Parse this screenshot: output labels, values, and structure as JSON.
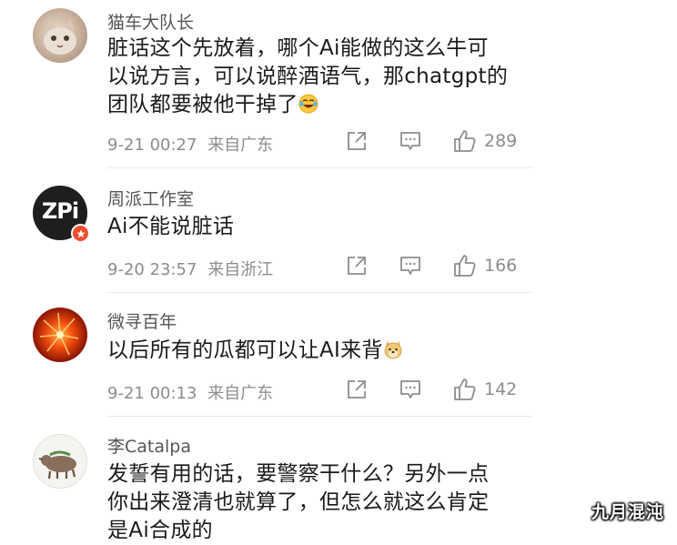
{
  "comments": [
    {
      "username": "猫车大队长",
      "content_lines": [
        "脏话这个先放着，哪个Ai能做的这么牛可",
        "以说方言，可以说醉酒语气，那chatgpt的",
        "团队都要被他干掉了"
      ],
      "emoji": "laughing-tears-emoji",
      "timestamp": "9-21 00:27",
      "location": "来自广东",
      "likes": "289"
    },
    {
      "username": "周派工作室",
      "avatar_text": "ZPi",
      "content_lines": [
        "Ai不能说脏话"
      ],
      "timestamp": "9-20 23:57",
      "location": "来自浙江",
      "likes": "166"
    },
    {
      "username": "微寻百年",
      "content_lines": [
        "以后所有的瓜都可以让AI来背"
      ],
      "emoji": "doge-emoji",
      "timestamp": "9-21 00:13",
      "location": "来自广东",
      "likes": "142"
    },
    {
      "username": "李Catalpa",
      "content_lines": [
        "发誓有用的话，要警察干什么？另外一点",
        "你出来澄清也就算了，但怎么就这么肯定",
        "是Ai合成的"
      ]
    }
  ],
  "watermark": "九月混沌",
  "colors": {
    "meta": "#8c8c8c",
    "divider": "#e8e8e8",
    "badge": "#f04e30"
  }
}
